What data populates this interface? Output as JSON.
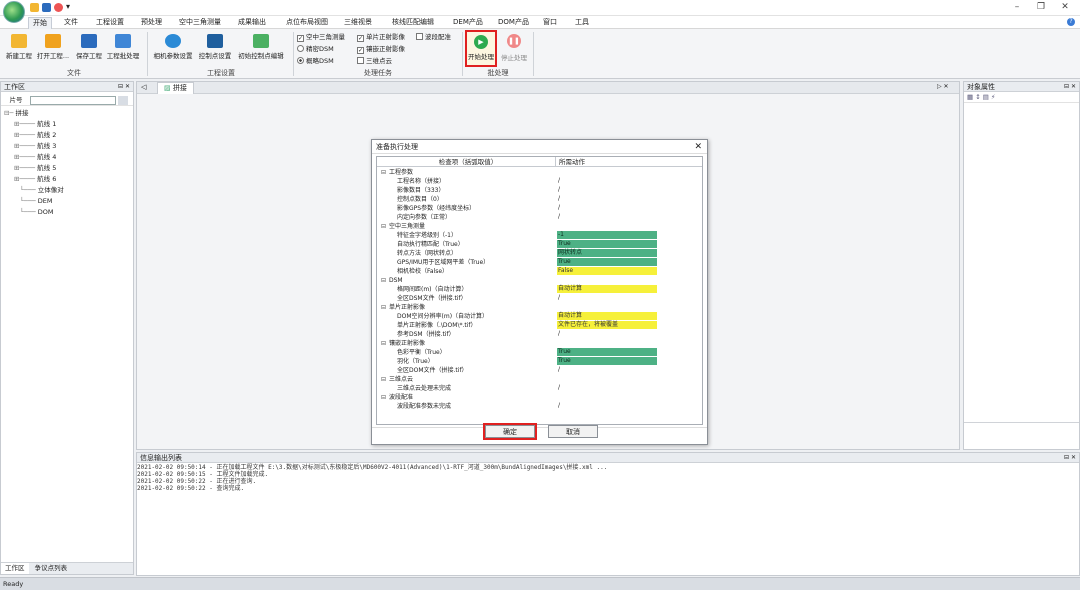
{
  "menu": {
    "tabs": [
      "开始",
      "文件",
      "工程设置",
      "预处理",
      "空中三角测量",
      "成果输出",
      "点位布局视图",
      "三维视景",
      "核线匹配编辑",
      "DEM产品",
      "DOM产品",
      "窗口",
      "工具"
    ]
  },
  "ribbon": {
    "file": {
      "buttons": [
        "新建工程",
        "打开工程...",
        "保存工程",
        "工程批处理"
      ],
      "label": "文件"
    },
    "project": {
      "buttons": [
        "相机参数设置",
        "控制点设置",
        "初始控制点编辑"
      ],
      "label": "工程设置"
    },
    "tasks": {
      "label": "处理任务",
      "items": [
        "空中三角测量",
        "精密DSM",
        "概略DSM",
        "单片正射影像",
        "镶嵌正射影像",
        "三维点云",
        "波段配准"
      ]
    },
    "batch": {
      "label": "批处理",
      "start": "开始处理",
      "stop": "停止处理"
    }
  },
  "workspace": {
    "title": "工作区",
    "search_label": "片号",
    "root": "拼接",
    "items": [
      "航线 1",
      "航线 2",
      "航线 3",
      "航线 4",
      "航线 5",
      "航线 6",
      "立体像对",
      "DEM",
      "DOM"
    ],
    "tabs": [
      "工作区",
      "争议点列表"
    ]
  },
  "doc": {
    "tab": "拼接"
  },
  "props": {
    "title": "对象属性"
  },
  "dialog": {
    "title": "准备执行处理",
    "col_check": "检查项（括弧取值）",
    "col_action": "所需动作",
    "ok": "确定",
    "cancel": "取消",
    "rows": [
      {
        "k": "工程参数",
        "a": "",
        "c": "",
        "lvl": 0
      },
      {
        "k": "工程名称（拼接）",
        "a": "/",
        "c": "",
        "lvl": 1
      },
      {
        "k": "影像数目（333）",
        "a": "/",
        "c": "",
        "lvl": 1
      },
      {
        "k": "控制点数目（0）",
        "a": "/",
        "c": "",
        "lvl": 1
      },
      {
        "k": "影像GPS参数（经纬度坐标）",
        "a": "/",
        "c": "",
        "lvl": 1
      },
      {
        "k": "内定向参数（正常）",
        "a": "/",
        "c": "",
        "lvl": 1
      },
      {
        "k": "空中三角测量",
        "a": "",
        "c": "",
        "lvl": 0
      },
      {
        "k": "特征金字塔级别（-1）",
        "a": "-1",
        "c": "g",
        "lvl": 1
      },
      {
        "k": "自动执行精匹配（True）",
        "a": "True",
        "c": "g",
        "lvl": 1
      },
      {
        "k": "转点方法（网状转点）",
        "a": "网状转点",
        "c": "g",
        "lvl": 1
      },
      {
        "k": "GPS/IMU用于区域网平差（True）",
        "a": "True",
        "c": "g",
        "lvl": 1
      },
      {
        "k": "相机检校（False）",
        "a": "False",
        "c": "y",
        "lvl": 1
      },
      {
        "k": "DSM",
        "a": "",
        "c": "",
        "lvl": 0
      },
      {
        "k": "格网间距(m)（自动计算）",
        "a": "自动计算",
        "c": "y",
        "lvl": 1
      },
      {
        "k": "全区DSM文件（拼接.tif）",
        "a": "/",
        "c": "",
        "lvl": 1
      },
      {
        "k": "单片正射影像",
        "a": "",
        "c": "",
        "lvl": 0
      },
      {
        "k": "DOM空间分辨率(m)（自动计算）",
        "a": "自动计算",
        "c": "y",
        "lvl": 1
      },
      {
        "k": "单片正射影像（.\\DOM\\*.tif）",
        "a": "文件已存在，将被覆盖",
        "c": "y",
        "lvl": 1
      },
      {
        "k": "参考DSM（拼接.tif）",
        "a": "/",
        "c": "",
        "lvl": 1
      },
      {
        "k": "镶嵌正射影像",
        "a": "",
        "c": "",
        "lvl": 0
      },
      {
        "k": "色彩平衡（True）",
        "a": "True",
        "c": "g",
        "lvl": 1
      },
      {
        "k": "羽化（True）",
        "a": "True",
        "c": "g",
        "lvl": 1
      },
      {
        "k": "全区DOM文件（拼接.tif）",
        "a": "/",
        "c": "",
        "lvl": 1
      },
      {
        "k": "三维点云",
        "a": "",
        "c": "",
        "lvl": 0
      },
      {
        "k": "三维点云处理未完成",
        "a": "/",
        "c": "",
        "lvl": 1
      },
      {
        "k": "波段配准",
        "a": "",
        "c": "",
        "lvl": 0
      },
      {
        "k": "波段配准参数未完成",
        "a": "/",
        "c": "",
        "lvl": 1
      }
    ]
  },
  "output": {
    "title": "信息输出列表",
    "lines": [
      "2021-02-02 09:50:14 - 正在加载工程文件 E:\\3.数据\\对标测试\\东极稳定后\\MD600V2-4011(Advanced)\\1-RTF_河道_300m\\BundAlignedImages\\拼接.xml ...",
      "2021-02-02 09:50:15 - 工程文件加载完成.",
      "2021-02-02 09:50:22 - 正在进行查询.",
      "2021-02-02 09:50:22 - 查询完成."
    ]
  },
  "status": {
    "text": "Ready"
  }
}
